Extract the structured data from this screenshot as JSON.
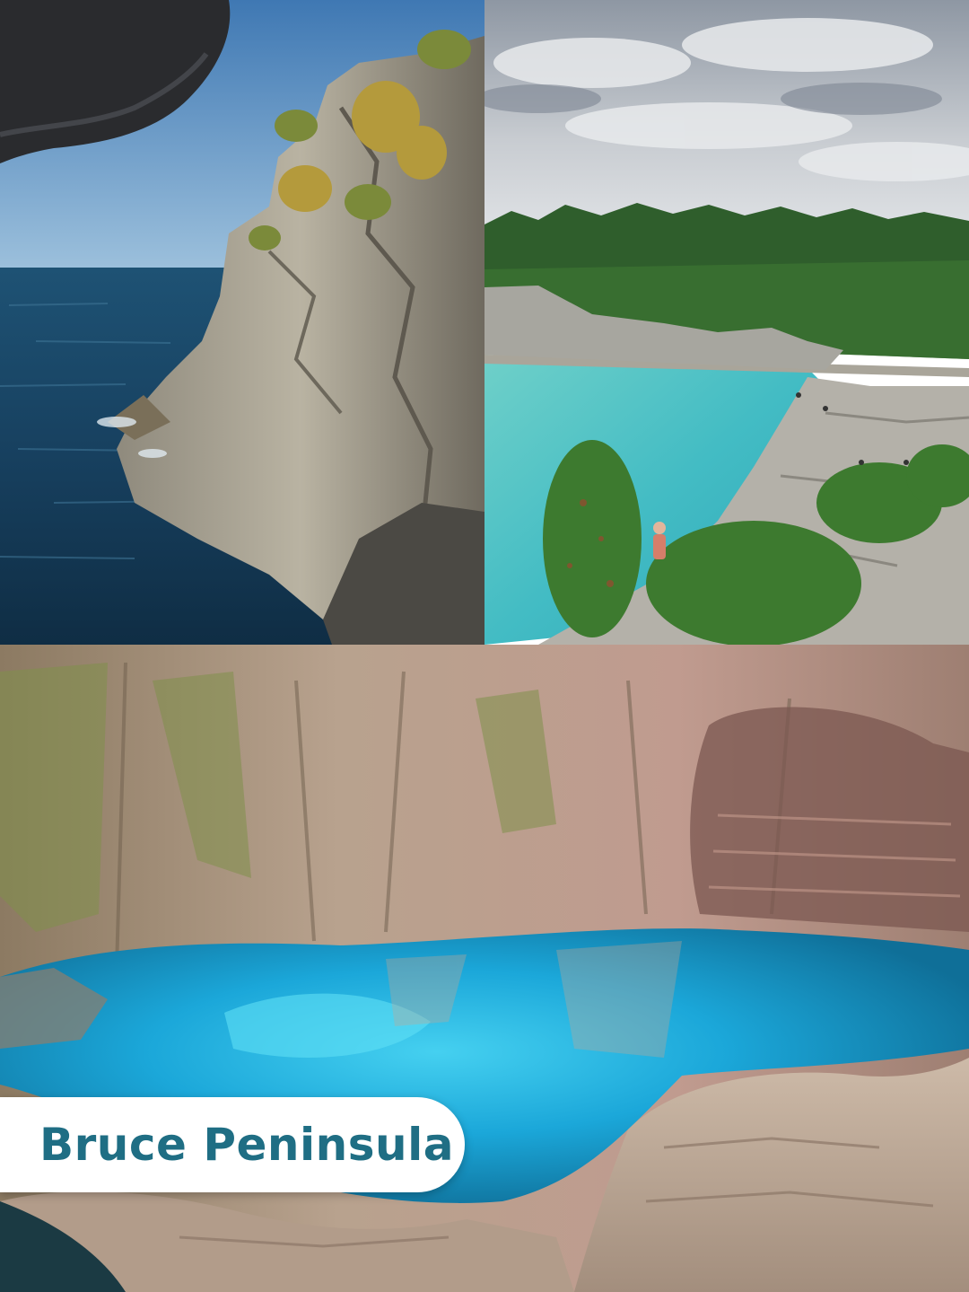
{
  "caption": {
    "title": "Bruce Peninsula",
    "text_color": "#1f6e84",
    "background": "#ffffff"
  },
  "photos": [
    {
      "name": "cliff-over-lake-photo",
      "position_label": "top-left"
    },
    {
      "name": "turquoise-cove-photo",
      "position_label": "top-right"
    },
    {
      "name": "grotto-cave-pool-photo",
      "position_label": "bottom"
    }
  ],
  "colors": {
    "deep_water": "#143c5a",
    "turquoise_water": "#4ec5c9",
    "grotto_water": "#1fa8d8",
    "limestone": "#b7aa93",
    "forest": "#2e5a2a",
    "sky_blue": "#5f94c4",
    "cloudy_sky": "#b9c0c8"
  }
}
